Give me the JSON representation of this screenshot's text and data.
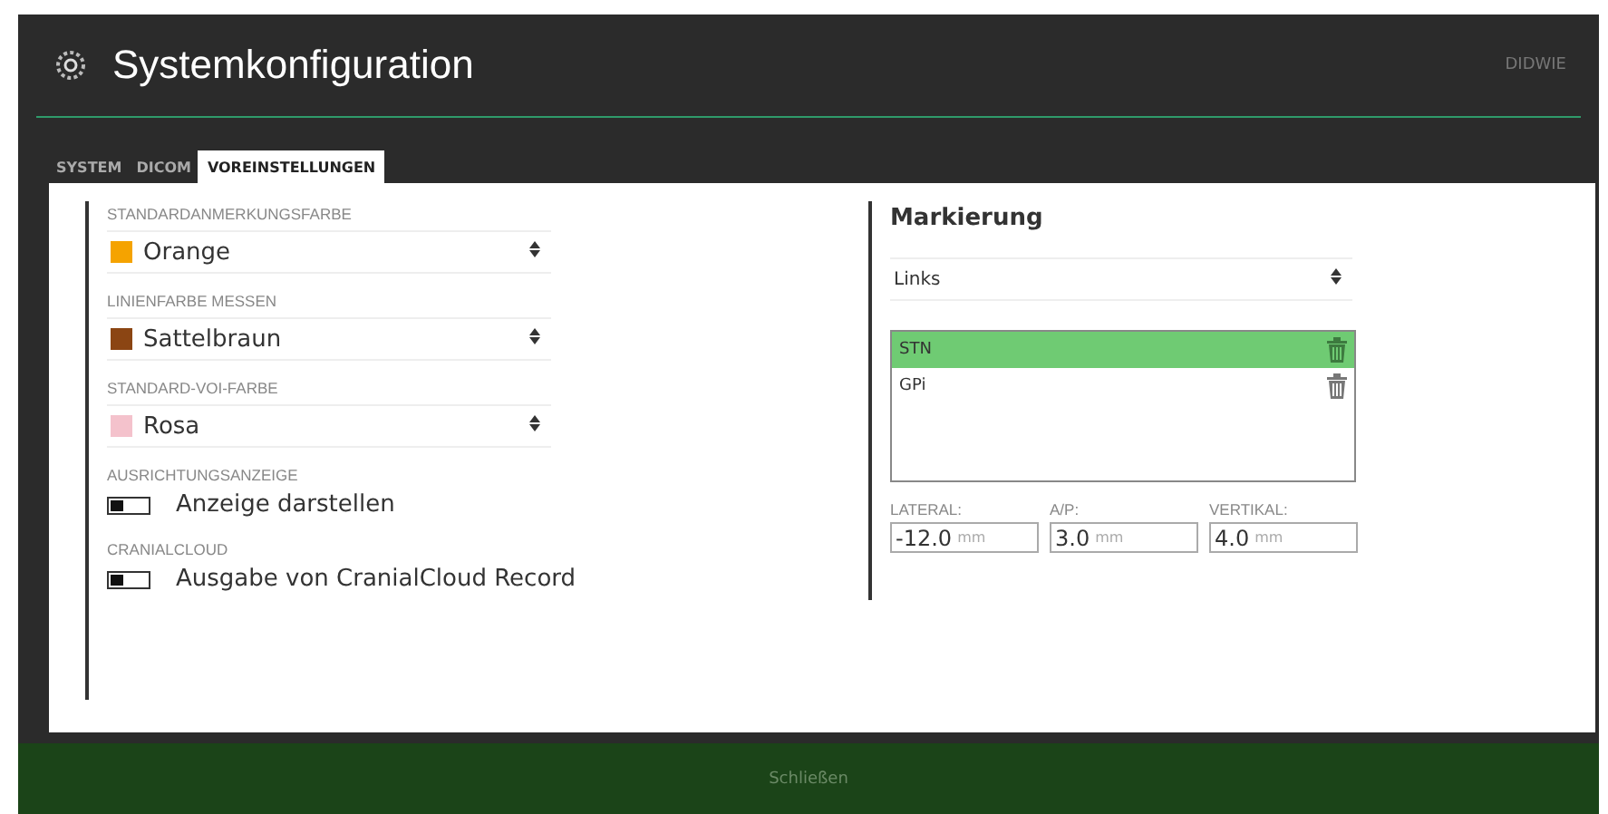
{
  "window": {
    "title": "Systemkonfiguration",
    "user": "DIDWIE"
  },
  "tabs": [
    {
      "label": "SYSTEM",
      "selected": false
    },
    {
      "label": "DICOM",
      "selected": false
    },
    {
      "label": "VOREINSTELLUNGEN",
      "selected": true
    }
  ],
  "settings": [
    {
      "kind": "select",
      "label": "STANDARDANMERKUNGSFARBE",
      "value": "Orange",
      "color": "#f5a300"
    },
    {
      "kind": "select",
      "label": "LINIENFARBE MESSEN",
      "value": "Sattelbraun",
      "color": "#8b4513"
    },
    {
      "kind": "select",
      "label": "STANDARD-VOI-FARBE",
      "value": "Rosa",
      "color": "#f4c2cc"
    },
    {
      "kind": "toggle",
      "label": "AUSRICHTUNGSANZEIGE",
      "value": "Anzeige darstellen",
      "on": false
    },
    {
      "kind": "toggle",
      "label": "CRANIALCLOUD",
      "value": "Ausgabe von CranialCloud Record",
      "on": false
    }
  ],
  "marking": {
    "title": "Markierung",
    "side": "Links",
    "targets": [
      {
        "name": "STN",
        "selected": true
      },
      {
        "name": "GPi",
        "selected": false
      }
    ],
    "coords": [
      {
        "label": "LATERAL:",
        "value": "-12.0",
        "unit": "mm"
      },
      {
        "label": "A/P:",
        "value": "3.0",
        "unit": "mm"
      },
      {
        "label": "VERTIKAL:",
        "value": "4.0",
        "unit": "mm"
      }
    ]
  },
  "footer": {
    "button": "Schließen"
  }
}
